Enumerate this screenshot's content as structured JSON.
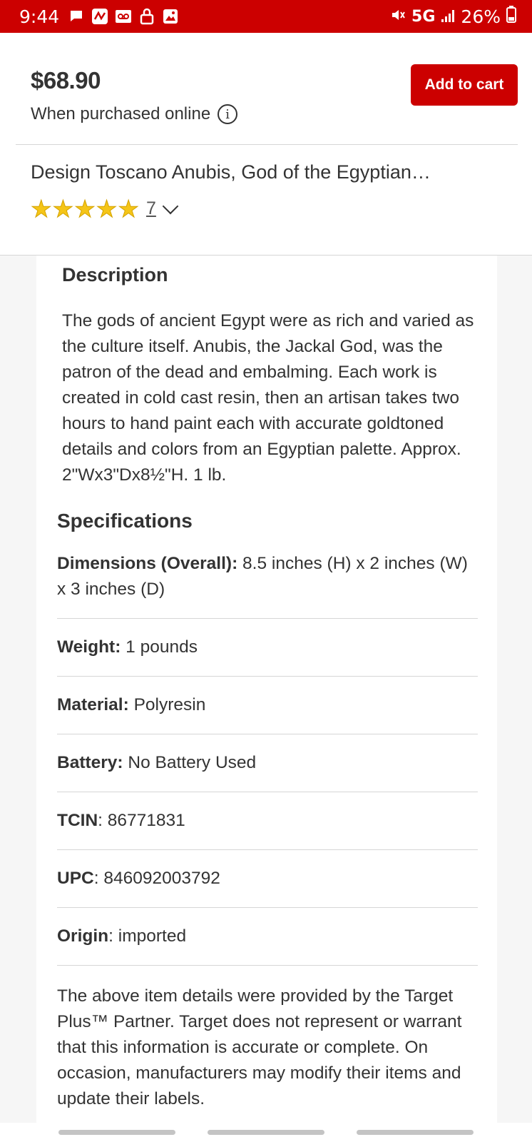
{
  "status_bar": {
    "time": "9:44",
    "network": "5G",
    "battery": "26%"
  },
  "header": {
    "price": "$68.90",
    "price_note": "When purchased online",
    "add_to_cart": "Add to cart",
    "title": "Design Toscano Anubis, God of the Egyptian…",
    "rating_value": 5,
    "review_count": "7"
  },
  "description": {
    "heading": "Description",
    "text": "The gods of ancient Egypt were as rich and varied as the culture itself. Anubis, the Jackal God, was the patron of the dead and embalming. Each work is created in cold cast resin, then an artisan takes two hours to hand paint each with accurate goldtoned details and colors from an Egyptian palette. Approx. 2\"Wx3\"Dx8½\"H. 1 lb."
  },
  "specifications": {
    "heading": "Specifications",
    "items": [
      {
        "label": "Dimensions (Overall):",
        "value": " 8.5 inches (H) x 2 inches (W) x 3 inches (D)"
      },
      {
        "label": "Weight:",
        "value": " 1 pounds"
      },
      {
        "label": "Material:",
        "value": " Polyresin"
      },
      {
        "label": "Battery:",
        "value": " No Battery Used"
      },
      {
        "label": "TCIN",
        "value": ": 86771831"
      },
      {
        "label": "UPC",
        "value": ": 846092003792"
      },
      {
        "label": "Origin",
        "value": ": imported"
      }
    ]
  },
  "disclaimer": "The above item details were provided by the Target Plus™ Partner. Target does not represent or warrant that this information is accurate or complete. On occasion, manufacturers may modify their items and update their labels.",
  "colors": {
    "brand_red": "#cc0000",
    "star": "#f5c518"
  }
}
